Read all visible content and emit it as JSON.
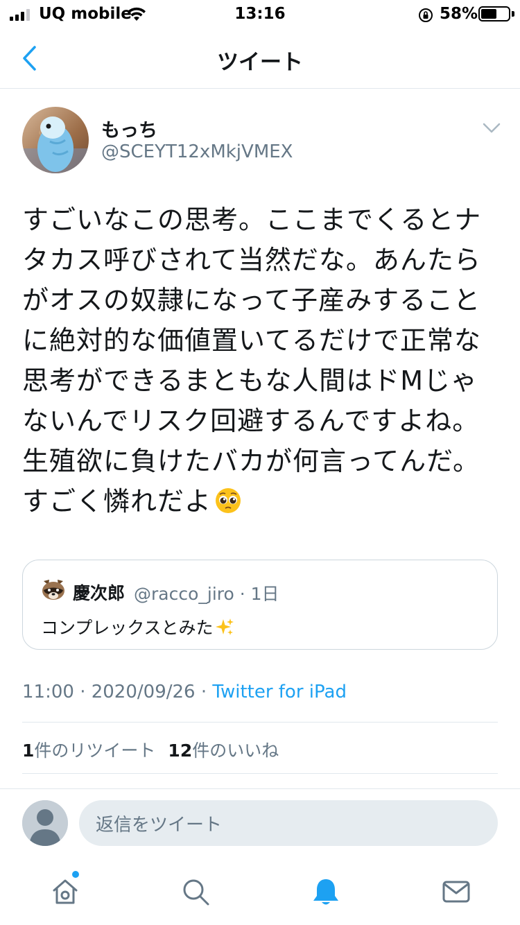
{
  "status_bar": {
    "carrier": "UQ mobile",
    "time": "13:16",
    "battery_percent": "58%",
    "battery_level": 0.58
  },
  "nav": {
    "title": "ツイート",
    "back_icon": "chevron-left-icon"
  },
  "tweet": {
    "display_name": "もっち",
    "handle": "@SCEYT12xMkjVMEX",
    "text": "すごいなこの思考。ここまでくるとナタカス呼びされて当然だな。あんたらがオスの奴隷になって子産みすることに絶対的な価値置いてるだけで正常な思考ができるまともな人間はドMじゃないんでリスク回避するんですよね。生殖欲に負けたバカが何言ってんだ。すごく憐れだよ",
    "text_emoji": "pleading-face-emoji",
    "timestamp": "11:00 · 2020/09/26 · ",
    "source": "Twitter for iPad",
    "retweet_count": "1",
    "retweet_label": "件のリツイート",
    "like_count": "12",
    "like_label": "件のいいね"
  },
  "quoted_tweet": {
    "display_name": "慶次郎",
    "handle_time": "@racco_jiro · 1日",
    "text": "コンプレックスとみた",
    "text_emoji": "sparkles-emoji"
  },
  "reply": {
    "placeholder": "返信をツイート"
  },
  "tabbar": {
    "items": [
      "home-icon",
      "search-icon",
      "notifications-icon",
      "messages-icon"
    ],
    "active": "notifications-icon",
    "home_has_new": true
  },
  "colors": {
    "accent": "#1da1f2",
    "text_primary": "#14171a",
    "text_secondary": "#657786",
    "border": "#e1e8ed"
  }
}
